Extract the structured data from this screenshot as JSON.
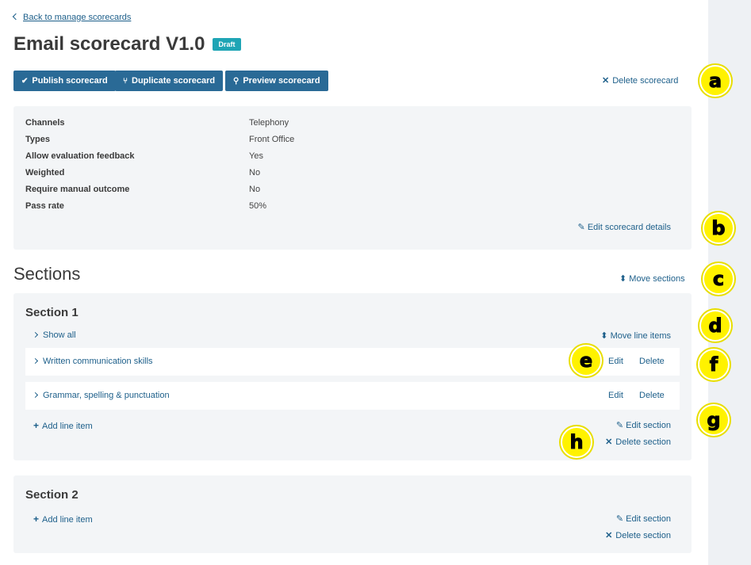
{
  "nav": {
    "back_label": "Back to manage scorecards"
  },
  "header": {
    "title": "Email scorecard V1.0",
    "badge": "Draft"
  },
  "toolbar": {
    "publish_label": "Publish scorecard",
    "duplicate_label": "Duplicate scorecard",
    "preview_label": "Preview scorecard",
    "delete_label": "Delete scorecard"
  },
  "details": {
    "rows": [
      {
        "label": "Channels",
        "value": "Telephony"
      },
      {
        "label": "Types",
        "value": "Front Office"
      },
      {
        "label": "Allow evaluation feedback",
        "value": "Yes"
      },
      {
        "label": "Weighted",
        "value": "No"
      },
      {
        "label": "Require manual outcome",
        "value": "No"
      },
      {
        "label": "Pass rate",
        "value": "50%"
      }
    ],
    "edit_label": "Edit scorecard details"
  },
  "sections_header": {
    "title": "Sections",
    "move_label": "Move sections"
  },
  "sections": [
    {
      "title": "Section 1",
      "show_all_label": "Show all",
      "move_line_items_label": "Move line items",
      "line_items": [
        {
          "label": "Written communication skills",
          "edit_label": "Edit",
          "delete_label": "Delete"
        },
        {
          "label": "Grammar, spelling & punctuation",
          "edit_label": "Edit",
          "delete_label": "Delete"
        }
      ],
      "add_line_label": "Add line item",
      "edit_label": "Edit section",
      "delete_label": "Delete section"
    },
    {
      "title": "Section 2",
      "add_line_label": "Add line item",
      "edit_label": "Edit section",
      "delete_label": "Delete section"
    }
  ],
  "callouts": [
    "a",
    "b",
    "c",
    "d",
    "e",
    "f",
    "g",
    "h"
  ],
  "colors": {
    "primary_button": "#2a6a96",
    "link": "#1d5f8a",
    "badge": "#1fa5b5",
    "callout": "#fff200",
    "panel": "#f3f5f7"
  }
}
